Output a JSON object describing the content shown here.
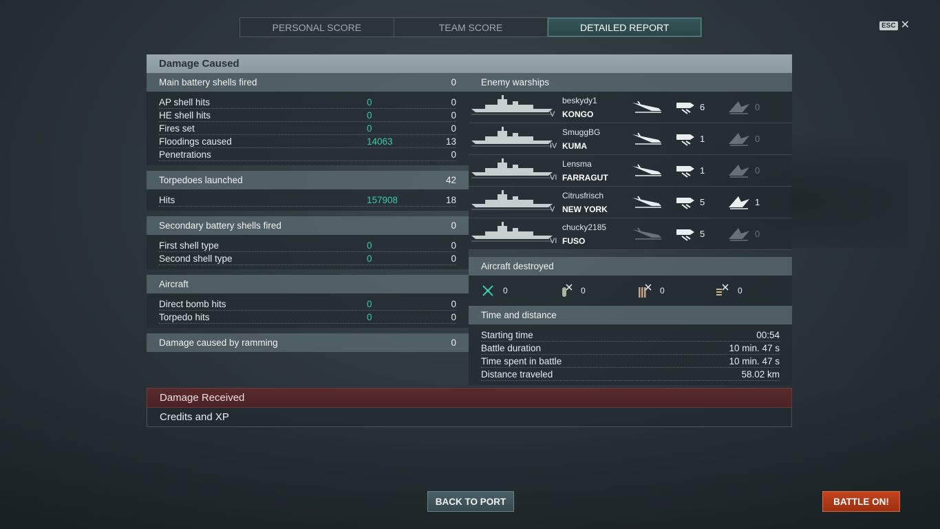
{
  "tabs": [
    {
      "label": "PERSONAL SCORE"
    },
    {
      "label": "TEAM SCORE"
    },
    {
      "label": "DETAILED REPORT"
    }
  ],
  "esc_label": "ESC",
  "close_glyph": "✕",
  "damage_caused": {
    "title": "Damage Caused",
    "main_battery": {
      "label": "Main battery shells fired",
      "value": "0",
      "rows": [
        {
          "label": "AP shell hits",
          "damage": "0",
          "count": "0"
        },
        {
          "label": "HE shell hits",
          "damage": "0",
          "count": "0"
        },
        {
          "label": "Fires set",
          "damage": "0",
          "count": "0"
        },
        {
          "label": "Floodings caused",
          "damage": "14063",
          "count": "13"
        },
        {
          "label": "Penetrations",
          "damage": "",
          "count": "0"
        }
      ]
    },
    "torpedoes": {
      "label": "Torpedoes launched",
      "value": "42",
      "rows": [
        {
          "label": "Hits",
          "damage": "157908",
          "count": "18"
        }
      ]
    },
    "secondary": {
      "label": "Secondary battery shells fired",
      "value": "0",
      "rows": [
        {
          "label": "First shell type",
          "damage": "0",
          "count": "0"
        },
        {
          "label": "Second shell type",
          "damage": "0",
          "count": "0"
        }
      ]
    },
    "aircraft": {
      "label": "Aircraft",
      "rows": [
        {
          "label": "Direct bomb hits",
          "damage": "0",
          "count": "0"
        },
        {
          "label": "Torpedo hits",
          "damage": "0",
          "count": "0"
        }
      ]
    },
    "ramming": {
      "label": "Damage caused by ramming",
      "value": "0"
    }
  },
  "enemy_warships": {
    "title": "Enemy warships",
    "ships": [
      {
        "player": "beskydy1",
        "ship": "KONGO",
        "tier": "V",
        "hits": "6",
        "kills": "0",
        "hit_active": true,
        "kill_active": false,
        "sink_active": true
      },
      {
        "player": "SmuggBG",
        "ship": "KUMA",
        "tier": "IV",
        "hits": "1",
        "kills": "0",
        "hit_active": true,
        "kill_active": false,
        "sink_active": true
      },
      {
        "player": "Lensma",
        "ship": "FARRAGUT",
        "tier": "VI",
        "hits": "1",
        "kills": "0",
        "hit_active": true,
        "kill_active": false,
        "sink_active": true
      },
      {
        "player": "Citrusfrisch",
        "ship": "NEW YORK",
        "tier": "V",
        "hits": "5",
        "kills": "1",
        "hit_active": true,
        "kill_active": true,
        "sink_active": true
      },
      {
        "player": "chucky2185",
        "ship": "FUSO",
        "tier": "VI",
        "hits": "5",
        "kills": "0",
        "hit_active": true,
        "kill_active": false,
        "sink_active": false
      }
    ]
  },
  "aircraft_destroyed": {
    "title": "Aircraft destroyed",
    "items": [
      {
        "icon": "fighter-icon",
        "value": "0"
      },
      {
        "icon": "bomber-icon",
        "value": "0"
      },
      {
        "icon": "torpedo-bomber-icon",
        "value": "0"
      },
      {
        "icon": "dive-bomber-icon",
        "value": "0"
      }
    ]
  },
  "time_distance": {
    "title": "Time and distance",
    "rows": [
      {
        "label": "Starting time",
        "value": "00:54"
      },
      {
        "label": "Battle duration",
        "value": "10 min. 47 s"
      },
      {
        "label": "Time spent in battle",
        "value": "10 min. 47 s"
      },
      {
        "label": "Distance traveled",
        "value": "58.02 km"
      }
    ]
  },
  "damage_received": {
    "label": "Damage Received"
  },
  "credits_xp": {
    "label": "Credits and XP"
  },
  "buttons": {
    "back_to_port": "BACK TO PORT",
    "battle_on": "BATTLE ON!"
  },
  "colors": {
    "accent_green": "#3ec9a3",
    "battle_button": "#c2441d",
    "received_bar": "#5a2a2c"
  }
}
